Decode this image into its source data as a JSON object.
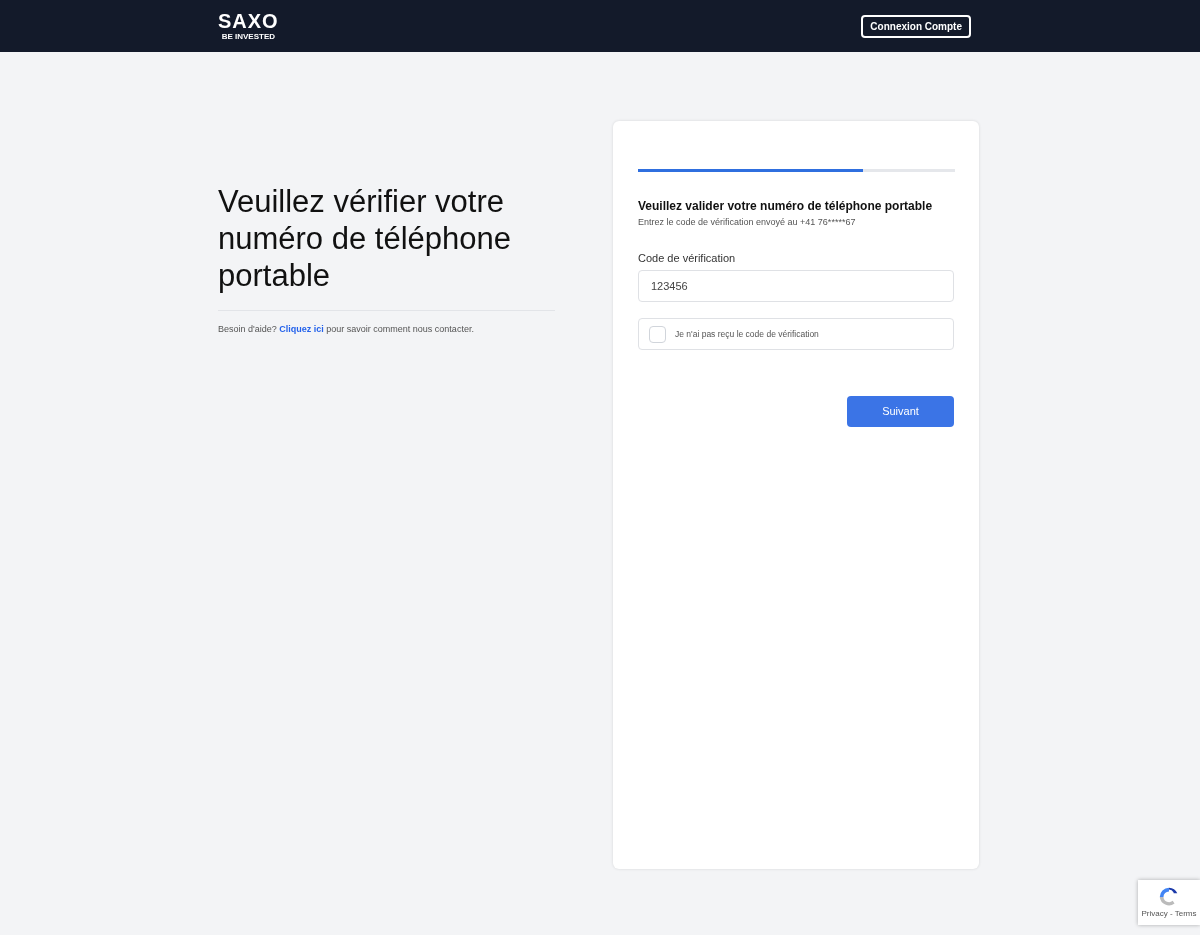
{
  "header": {
    "logo": "SAXO",
    "tagline": "BE INVESTED",
    "login_button": "Connexion Compte"
  },
  "intro": {
    "title": "Veuillez vérifier votre numéro de téléphone portable",
    "help_before": "Besoin d'aide?",
    "help_link": "Cliquez ici",
    "help_after": "pour savoir comment nous contacter."
  },
  "form": {
    "progress": {
      "level": 0.71
    },
    "heading": "Veuillez valider votre numéro de téléphone portable",
    "subtitle": "Entrez le code de vérification envoyé au +41 76*****67",
    "code_label": "Code de vérification",
    "code_value": "123456",
    "no_code": {
      "label": "Je n'ai pas reçu le code de vérification",
      "checked": false
    },
    "next_button": "Suivant"
  },
  "recaptcha": {
    "links": "Privacy - Terms"
  }
}
